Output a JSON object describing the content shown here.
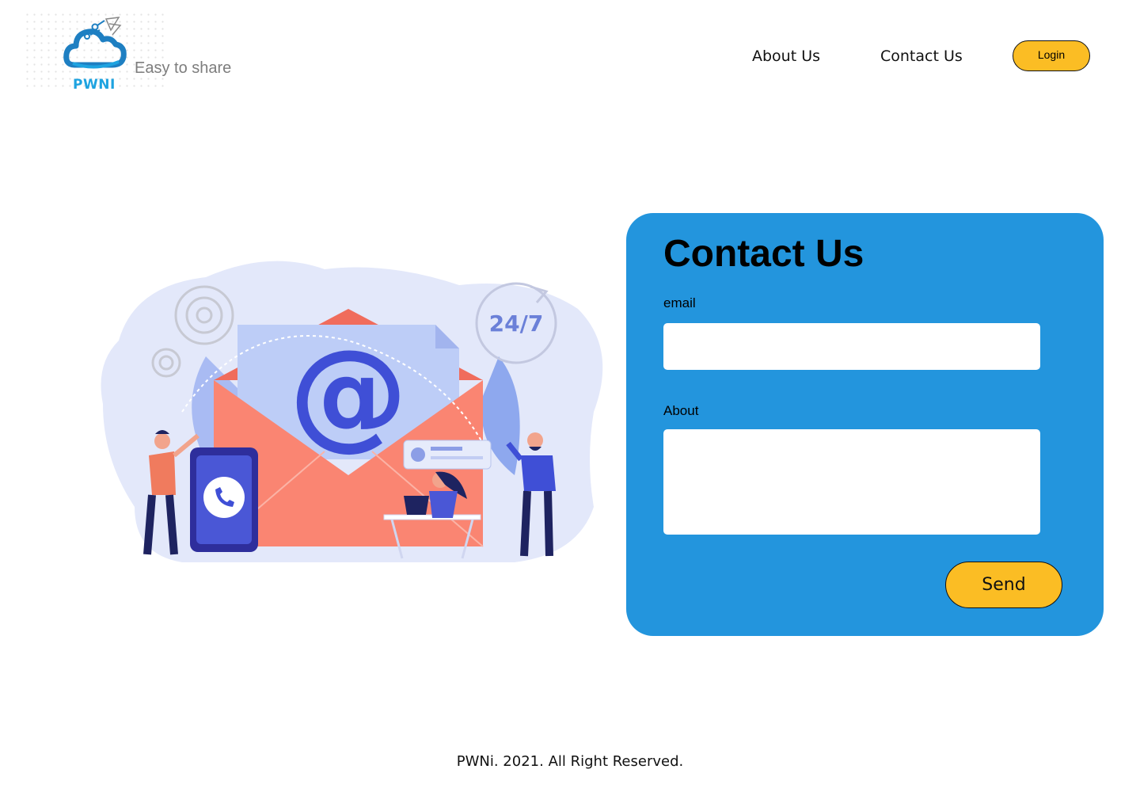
{
  "brand": {
    "logo_text": "PWNI",
    "tagline": "Easy to share",
    "accent": "#1ea3e0"
  },
  "nav": {
    "about_label": "About Us",
    "contact_label": "Contact Us",
    "login_label": "Login"
  },
  "illustration": {
    "badge_text": "24/7",
    "at_symbol": "@"
  },
  "contact": {
    "title": "Contact Us",
    "email_label": "email",
    "email_value": "",
    "about_label": "About",
    "about_value": "",
    "send_label": "Send",
    "card_color": "#2395dd",
    "button_color": "#fbbd24"
  },
  "footer": {
    "text": "PWNi. 2021. All Right Reserved."
  }
}
